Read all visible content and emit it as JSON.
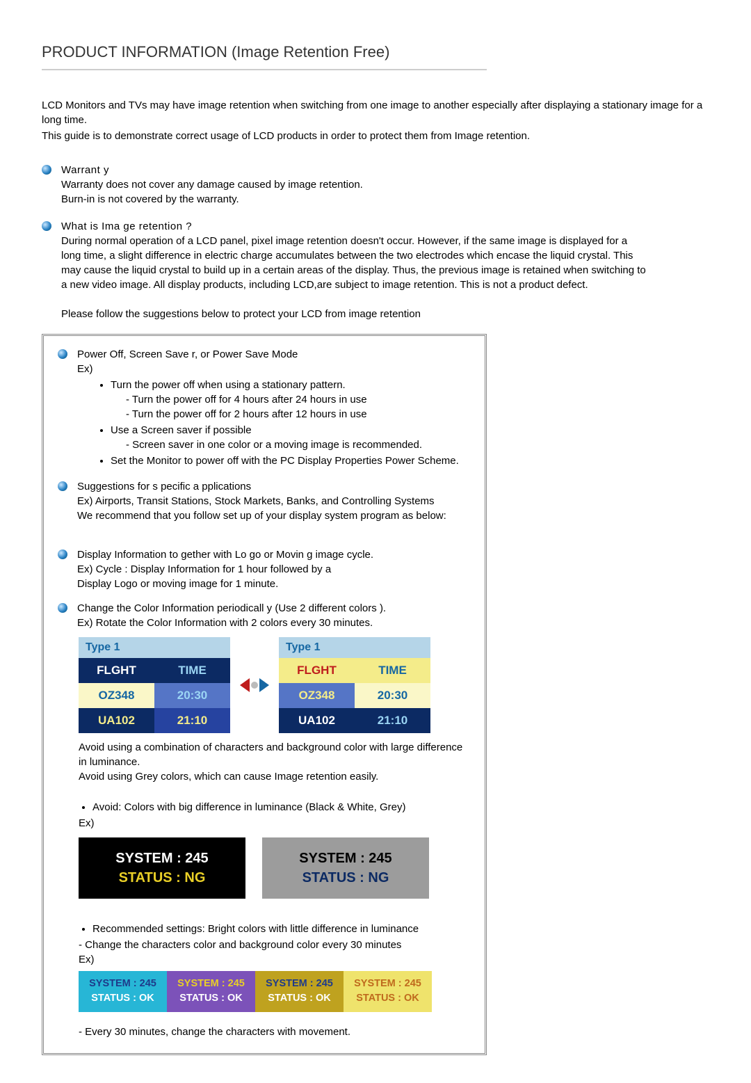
{
  "title": "PRODUCT INFORMATION (Image Retention Free)",
  "intro": {
    "p1": "LCD Monitors and TVs may have image retention when switching from one image to another especially after displaying a stationary image for a long time.",
    "p2": "This guide is to demonstrate correct usage of LCD products in order to protect them from Image retention."
  },
  "warranty": {
    "title": "Warrant y",
    "l1": "Warranty does not cover any damage caused by image retention.",
    "l2": "Burn-in is not covered by the warranty."
  },
  "whatIs": {
    "title": "What is Ima ge retention ?",
    "body": "During normal operation of a LCD panel, pixel image retention doesn't occur. However, if the same image is displayed for a long time, a slight difference in electric charge accumulates between the two electrodes which encase the liquid crystal. This may cause the liquid crystal to build up in a certain areas of the display. Thus, the previous image is retained when switching to a new video image. All display products, including LCD,are subject to image retention. This is not a product defect.",
    "follow": "Please follow the suggestions below to protect your LCD from image retention"
  },
  "box": {
    "powerOff": {
      "title": "Power Off, Screen Save  r, or Power Save Mode",
      "ex": "Ex)",
      "li1": "Turn the power off when using a stationary pattern.",
      "li1a": "- Turn the power off for 4 hours after 24 hours in use",
      "li1b": "- Turn the power off for 2 hours after 12 hours in use",
      "li2": "Use a Screen saver if possible",
      "li2a": "- Screen saver in one color or a moving image is recommended.",
      "li3": "Set the Monitor to power off with the PC Display Properties Power Scheme."
    },
    "suggestions": {
      "title": "Suggestions for s  pecific a pplications",
      "l1": "Ex) Airports, Transit Stations, Stock Markets, Banks, and Controlling Systems",
      "l2": "We recommend that you follow set up of your display system program as below:"
    },
    "display": {
      "title": "Display Information to  gether with Lo  go or Movin g image cycle.",
      "l1": "Ex) Cycle : Display Information for 1 hour followed by a",
      "l2": "Display Logo or moving image for 1 minute."
    },
    "change": {
      "title": "Change the Color Information    periodicall y (Use 2 different colors  ).",
      "l1": "Ex) Rotate the Color Information with 2 colors every 30 minutes."
    },
    "typeTables": {
      "label": "Type 1",
      "hdr1": "FLGHT",
      "hdr2": "TIME",
      "r1c1": "OZ348",
      "r1c2": "20:30",
      "r2c1": "UA102",
      "r2c2": "21:10"
    },
    "avoidText": {
      "l1": "Avoid using a combination of characters and background color with large difference in luminance.",
      "l2": "Avoid using Grey colors, which can cause Image retention easily."
    },
    "avoidLi": "Avoid: Colors with big difference in luminance (Black & White, Grey)",
    "exLabel": "Ex)",
    "status": {
      "sys": "SYSTEM : 245",
      "stat": "STATUS : NG"
    },
    "recLi": "Recommended settings: Bright colors with little difference in luminance",
    "recSub": "- Change the characters color and background color every 30 minutes",
    "ok": {
      "sys": "SYSTEM : 245",
      "stat": "STATUS : OK"
    },
    "finalNote": "- Every 30 minutes, change the characters with movement."
  }
}
